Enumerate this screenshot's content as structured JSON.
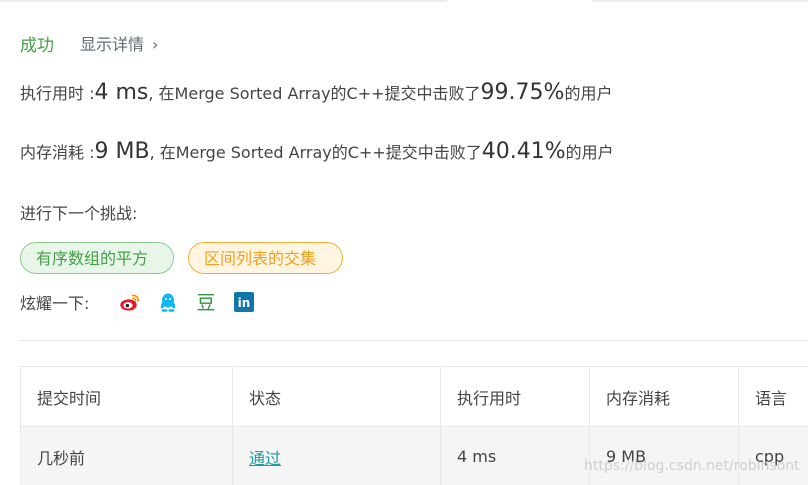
{
  "status": {
    "result": "成功",
    "details_link": "显示详情",
    "chevron": "›"
  },
  "runtime": {
    "label": "执行用时 : ",
    "value": "4 ms",
    "text_mid": ", 在Merge Sorted Array的C++提交中击败了",
    "percent": "99.75%",
    "text_end": " 的用户"
  },
  "memory": {
    "label": "内存消耗 : ",
    "value": "9 MB",
    "text_mid": ", 在Merge Sorted Array的C++提交中击败了",
    "percent": "40.41%",
    "text_end": " 的用户"
  },
  "challenge": {
    "label": "进行下一个挑战:",
    "tags": [
      "有序数组的平方",
      "区间列表的交集"
    ]
  },
  "share": {
    "label": "炫耀一下:",
    "icons": [
      "weibo-icon",
      "qq-icon",
      "douban-icon",
      "linkedin-icon"
    ],
    "douban_glyph": "豆",
    "linkedin_glyph": "in"
  },
  "table": {
    "headers": [
      "提交时间",
      "状态",
      "执行用时",
      "内存消耗",
      "语言"
    ],
    "rows": [
      [
        "几秒前",
        "通过",
        "4 ms",
        "9 MB",
        "cpp"
      ]
    ]
  },
  "watermark": "https://blog.csdn.net/robinsont",
  "colors": {
    "success": "#43a047",
    "tag_green": "#43a047",
    "tag_orange": "#f0a020",
    "pass_link": "#1a9c9c",
    "weibo": "#e6162d",
    "qq": "#12b7f5",
    "douban": "#2e963d",
    "linkedin": "#0e76a8"
  }
}
